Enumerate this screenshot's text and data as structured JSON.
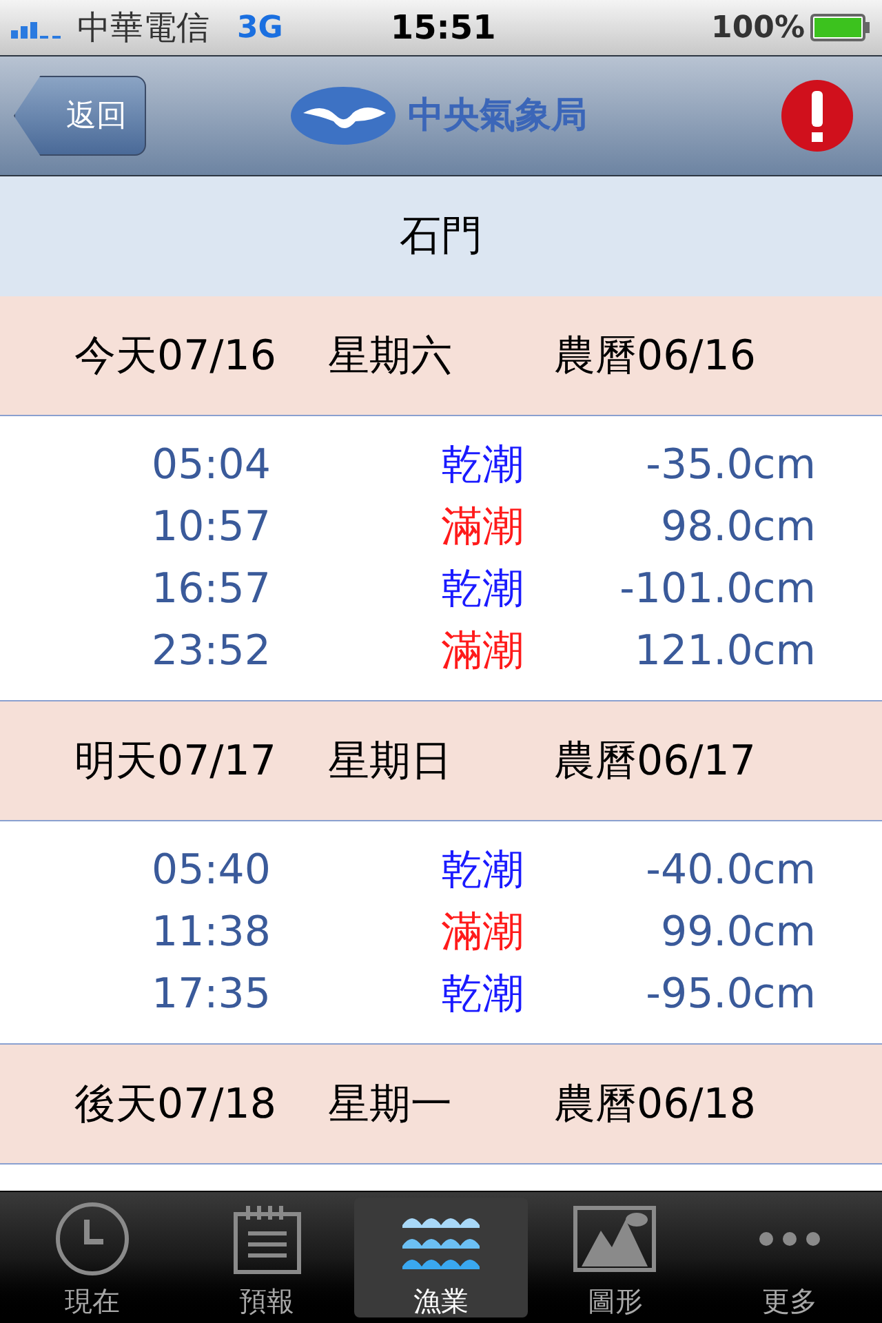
{
  "status_bar": {
    "carrier": "中華電信",
    "network": "3G",
    "time": "15:51",
    "battery": "100%"
  },
  "nav_bar": {
    "back": "返回",
    "logo_text": "中央氣象局"
  },
  "station": "石門",
  "days": [
    {
      "day": "今天07/16",
      "weekday": "星期六",
      "lunar": "農曆06/16",
      "tides": [
        {
          "time": "05:04",
          "kind": "low",
          "label": "乾潮",
          "height": "-35.0cm"
        },
        {
          "time": "10:57",
          "kind": "high",
          "label": "滿潮",
          "height": "98.0cm"
        },
        {
          "time": "16:57",
          "kind": "low",
          "label": "乾潮",
          "height": "-101.0cm"
        },
        {
          "time": "23:52",
          "kind": "high",
          "label": "滿潮",
          "height": "121.0cm"
        }
      ]
    },
    {
      "day": "明天07/17",
      "weekday": "星期日",
      "lunar": "農曆06/17",
      "tides": [
        {
          "time": "05:40",
          "kind": "low",
          "label": "乾潮",
          "height": "-40.0cm"
        },
        {
          "time": "11:38",
          "kind": "high",
          "label": "滿潮",
          "height": "99.0cm"
        },
        {
          "time": "17:35",
          "kind": "low",
          "label": "乾潮",
          "height": "-95.0cm"
        }
      ]
    },
    {
      "day": "後天07/18",
      "weekday": "星期一",
      "lunar": "農曆06/18"
    }
  ],
  "tab_bar": [
    {
      "label": "現在",
      "kind": "clock",
      "selected": false
    },
    {
      "label": "預報",
      "kind": "notepad",
      "selected": false
    },
    {
      "label": "漁業",
      "kind": "waves",
      "selected": true
    },
    {
      "label": "圖形",
      "kind": "image",
      "selected": false
    },
    {
      "label": "更多",
      "kind": "more",
      "selected": false
    }
  ]
}
